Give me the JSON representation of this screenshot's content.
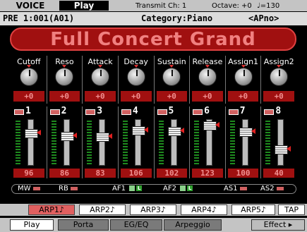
{
  "header": {
    "mode": "VOICE",
    "submode": "Play",
    "transmit": "Transmit Ch: 1",
    "octave": "Octave: +0",
    "tempo": "♩=130"
  },
  "voice_info": {
    "number": "PRE 1:001(A01)",
    "category": "Category:Piano",
    "subcategory": "<APno>"
  },
  "voice_name": "Full Concert Grand",
  "knobs": [
    {
      "label": "Cutoff",
      "value": "+0"
    },
    {
      "label": "Reso",
      "value": "+0"
    },
    {
      "label": "Attack",
      "value": "+0"
    },
    {
      "label": "Decay",
      "value": "+0"
    },
    {
      "label": "Sustain",
      "value": "+0"
    },
    {
      "label": "Release",
      "value": "+0"
    },
    {
      "label": "Assign1",
      "value": "+0"
    },
    {
      "label": "Assign2",
      "value": "+0"
    }
  ],
  "faders": [
    {
      "num": "1",
      "value": "96",
      "level": 96
    },
    {
      "num": "2",
      "value": "86",
      "level": 86
    },
    {
      "num": "3",
      "value": "83",
      "level": 83
    },
    {
      "num": "4",
      "value": "106",
      "level": 106
    },
    {
      "num": "5",
      "value": "102",
      "level": 102
    },
    {
      "num": "6",
      "value": "123",
      "level": 123
    },
    {
      "num": "7",
      "value": "100",
      "level": 100
    },
    {
      "num": "8",
      "value": "40",
      "level": 40
    }
  ],
  "controllers": {
    "mw": "MW",
    "rb": "RB",
    "af1": "AF1",
    "af2": "AF2",
    "as1": "AS1",
    "as2": "AS2",
    "chip_l": "L"
  },
  "arp_buttons": [
    "ARP1♪",
    "ARP2♪",
    "ARP3♪",
    "ARP4♪",
    "ARP5♪",
    "TAP"
  ],
  "tabs": [
    "Play",
    "Porta",
    "EG/EQ",
    "Arpeggio",
    "Effect ▸"
  ],
  "colors": {
    "accent_red": "#a01010",
    "active_arp": "#e06060",
    "meter_green": "#1e8a1e"
  }
}
